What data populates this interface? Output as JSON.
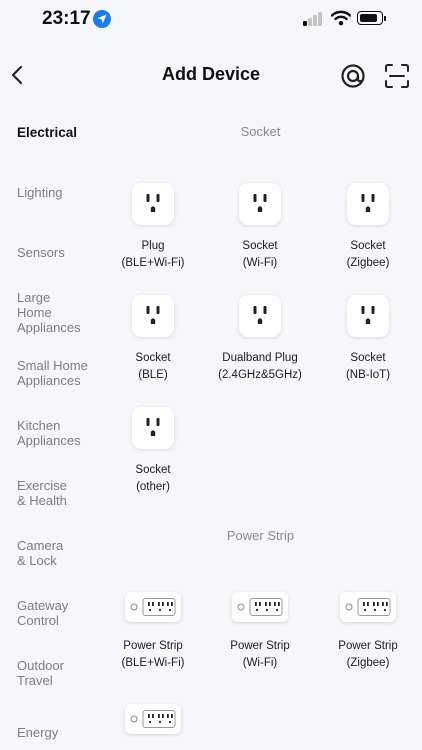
{
  "status_bar": {
    "time": "23:17",
    "battery_level": 0.8,
    "signal_bars_active": 1,
    "icons": [
      "location-arrow-icon",
      "cellular-signal-icon",
      "wifi-icon",
      "battery-icon"
    ]
  },
  "header": {
    "title": "Add Device",
    "icons": [
      "chevron-left-icon",
      "at-sign-scan-icon",
      "qr-scan-icon"
    ]
  },
  "sidebar": {
    "items": [
      {
        "label": "Electrical",
        "active": true
      },
      {
        "label": "Lighting",
        "active": false
      },
      {
        "label": "Sensors",
        "active": false
      },
      {
        "label": "Large Home Appliances",
        "active": false
      },
      {
        "label": "Small Home Appliances",
        "active": false
      },
      {
        "label": "Kitchen Appliances",
        "active": false
      },
      {
        "label": "Exercise & Health",
        "active": false
      },
      {
        "label": "Camera & Lock",
        "active": false
      },
      {
        "label": "Gateway Control",
        "active": false
      },
      {
        "label": "Outdoor Travel",
        "active": false
      },
      {
        "label": "Energy",
        "active": false
      }
    ]
  },
  "main": {
    "sections": [
      {
        "title": "Socket",
        "devices": [
          {
            "name": "Plug",
            "protocol": "(BLE+Wi-Fi)",
            "icon": "wall-socket-icon"
          },
          {
            "name": "Socket",
            "protocol": "(Wi-Fi)",
            "icon": "wall-socket-icon"
          },
          {
            "name": "Socket",
            "protocol": "(Zigbee)",
            "icon": "wall-socket-icon"
          },
          {
            "name": "Socket",
            "protocol": "(BLE)",
            "icon": "wall-socket-icon"
          },
          {
            "name": "Dualband Plug",
            "protocol": "(2.4GHz&5GHz)",
            "icon": "wall-socket-icon"
          },
          {
            "name": "Socket",
            "protocol": "(NB-IoT)",
            "icon": "wall-socket-icon"
          },
          {
            "name": "Socket",
            "protocol": "(other)",
            "icon": "wall-socket-icon"
          }
        ]
      },
      {
        "title": "Power Strip",
        "devices": [
          {
            "name": "Power Strip",
            "protocol": "(BLE+Wi-Fi)",
            "icon": "power-strip-icon"
          },
          {
            "name": "Power Strip",
            "protocol": "(Wi-Fi)",
            "icon": "power-strip-icon"
          },
          {
            "name": "Power Strip",
            "protocol": "(Zigbee)",
            "icon": "power-strip-icon"
          },
          {
            "name": "",
            "protocol": "",
            "icon": "power-strip-icon"
          }
        ]
      }
    ]
  },
  "colors": {
    "background": "#f5f7fa",
    "tile": "#ffffff",
    "accent_blue": "#1a7cf5",
    "text_primary": "#1c1c1e",
    "text_secondary": "#8a8a8f"
  }
}
